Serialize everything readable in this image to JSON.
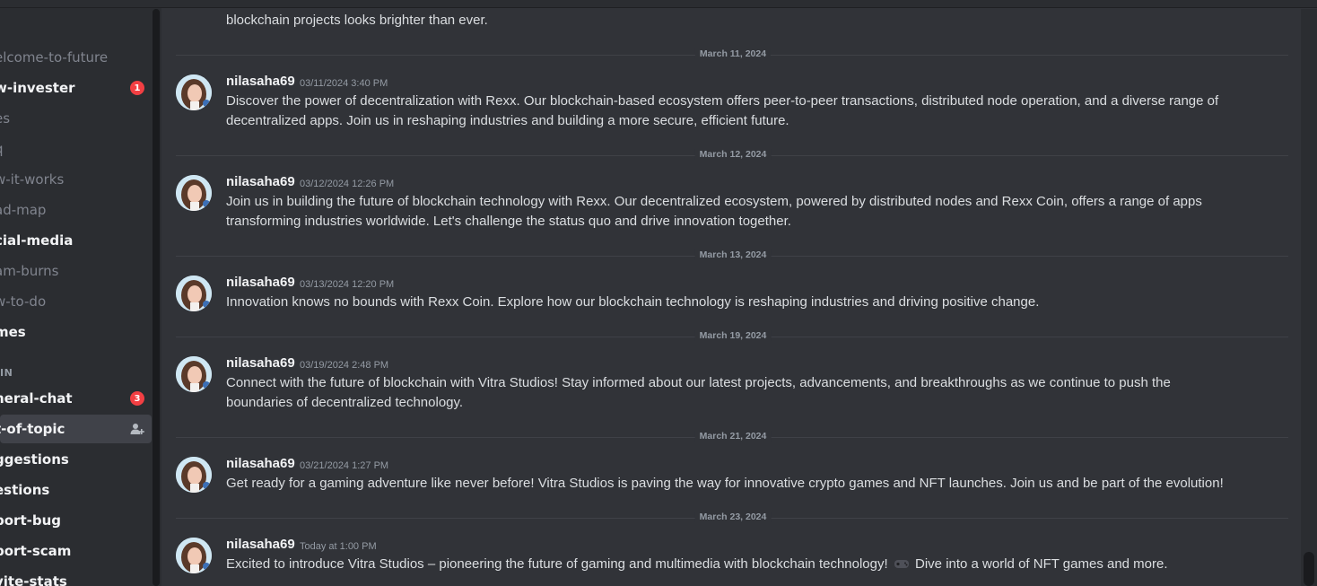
{
  "sidebar": {
    "channels": [
      {
        "name": "elcome-to-future",
        "unread": false,
        "badge": null
      },
      {
        "name": "w-invester",
        "unread": true,
        "badge": "1"
      },
      {
        "name": "es",
        "unread": false,
        "badge": null
      },
      {
        "name": "q",
        "unread": false,
        "badge": null
      },
      {
        "name": "w-it-works",
        "unread": false,
        "badge": null
      },
      {
        "name": "ad-map",
        "unread": false,
        "badge": null
      },
      {
        "name": "cial-media",
        "unread": true,
        "badge": null
      },
      {
        "name": "am-burns",
        "unread": false,
        "badge": null
      },
      {
        "name": "w-to-do",
        "unread": false,
        "badge": null
      },
      {
        "name": "mes",
        "unread": true,
        "badge": null
      }
    ],
    "category_label": "IN",
    "channels2": [
      {
        "name": "neral-chat",
        "unread": true,
        "badge": "3"
      },
      {
        "name": "t-of-topic",
        "unread": true,
        "active": true
      },
      {
        "name": "ggestions",
        "unread": true
      },
      {
        "name": "estions",
        "unread": true
      },
      {
        "name": "port-bug",
        "unread": true
      },
      {
        "name": "port-scam",
        "unread": true
      },
      {
        "name": "vite-stats",
        "unread": true
      }
    ]
  },
  "chat": {
    "top_partial_text": "blockchain projects looks brighter than ever.",
    "days": [
      {
        "label": "March 11, 2024"
      },
      {
        "label": "March 12, 2024"
      },
      {
        "label": "March 13, 2024"
      },
      {
        "label": "March 19, 2024"
      },
      {
        "label": "March 21, 2024"
      },
      {
        "label": "March 23, 2024"
      }
    ],
    "messages": [
      {
        "author": "nilasaha69",
        "time": "03/11/2024 3:40 PM",
        "line1": "Discover the power of decentralization with Rexx. Our blockchain-based ecosystem offers peer-to-peer transactions, distributed node operation, and a diverse range of",
        "line2": "decentralized apps. Join us in reshaping industries and building a more secure, efficient future."
      },
      {
        "author": "nilasaha69",
        "time": "03/12/2024 12:26 PM",
        "line1": "Join us in building the future of blockchain technology with Rexx. Our decentralized ecosystem, powered by distributed nodes and Rexx Coin, offers a range of apps",
        "line2": "transforming industries worldwide. Let's challenge the status quo and drive innovation together."
      },
      {
        "author": "nilasaha69",
        "time": "03/13/2024 12:20 PM",
        "line1": "Innovation knows no bounds with Rexx Coin. Explore how our blockchain technology is reshaping industries and driving positive change.",
        "line2": ""
      },
      {
        "author": "nilasaha69",
        "time": "03/19/2024 2:48 PM",
        "line1": "Connect with the future of blockchain with Vitra Studios! Stay informed about our latest projects, advancements, and breakthroughs as we continue to push the",
        "line2": "boundaries of decentralized technology."
      },
      {
        "author": "nilasaha69",
        "time": "03/21/2024 1:27 PM",
        "line1": "Get ready for a gaming adventure like never before! Vitra Studios is paving the way for innovative crypto games and NFT launches. Join us and be part of the evolution!",
        "line2": ""
      },
      {
        "author": "nilasaha69",
        "time": "Today at 1:00 PM",
        "line1_a": "Excited to introduce Vitra Studios – pioneering the future of gaming and multimedia with blockchain technology!",
        "line1_b": "Dive into a world of NFT games and more.",
        "line2": ""
      }
    ]
  },
  "colors": {
    "accent_red": "#f23f43",
    "bg_chat": "#313338",
    "bg_sidebar": "#2b2d31"
  }
}
